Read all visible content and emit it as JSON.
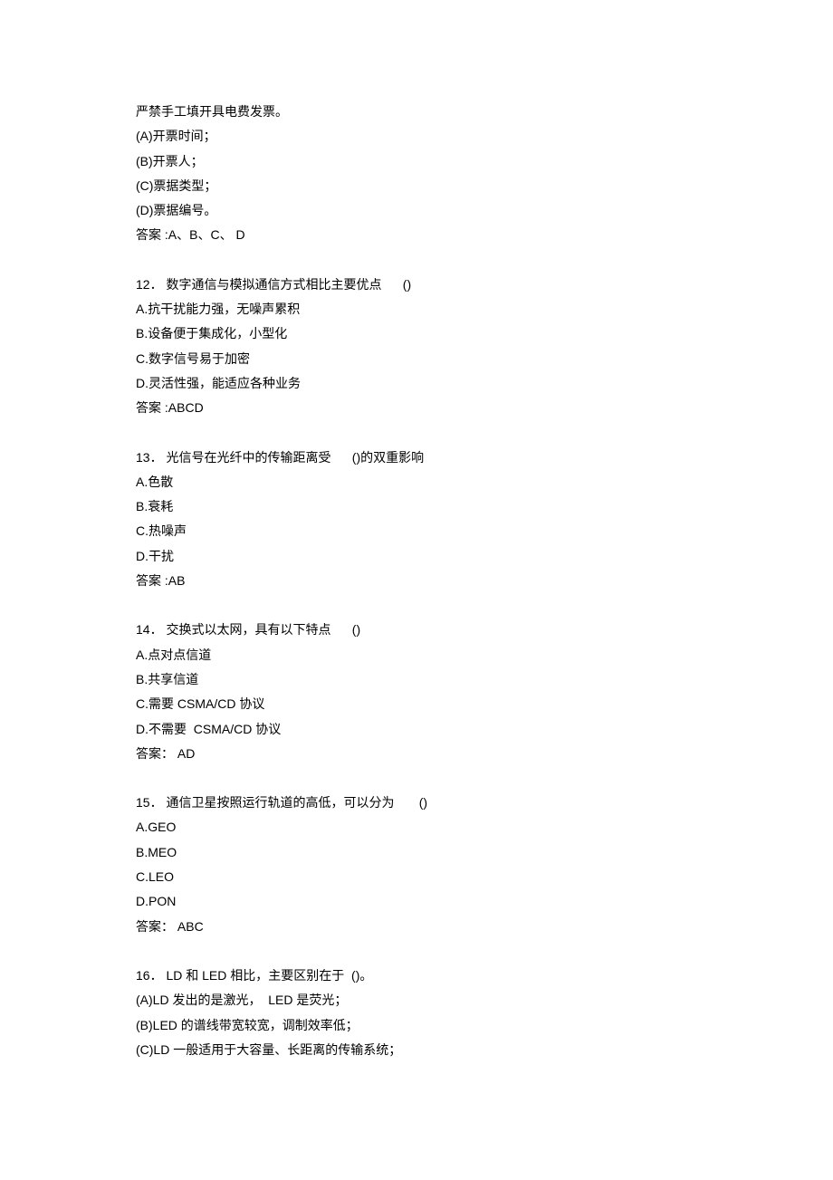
{
  "intro": {
    "line": "严禁手工填开具电费发票。",
    "optA": "(A)开票时间；",
    "optB": "(B)开票人；",
    "optC": "(C)票据类型；",
    "optD": "(D)票据编号。",
    "answer": "答案 :A、B、C、 D"
  },
  "q12": {
    "stem": "12． 数字通信与模拟通信方式相比主要优点      ()",
    "optA": "A.抗干扰能力强，无噪声累积",
    "optB": "B.设备便于集成化，小型化",
    "optC": "C.数字信号易于加密",
    "optD": "D.灵活性强，能适应各种业务",
    "answer": "答案 :ABCD"
  },
  "q13": {
    "stem": "13． 光信号在光纤中的传输距离受      ()的双重影响",
    "optA": "A.色散",
    "optB": "B.衰耗",
    "optC": "C.热噪声",
    "optD": "D.干扰",
    "answer": "答案 :AB"
  },
  "q14": {
    "stem": "14． 交换式以太网，具有以下特点      ()",
    "optA": "A.点对点信道",
    "optB": "B.共享信道",
    "optC": "C.需要 CSMA/CD 协议",
    "optD": "D.不需要  CSMA/CD 协议",
    "answer": "答案： AD"
  },
  "q15": {
    "stem": "15． 通信卫星按照运行轨道的高低，可以分为       ()",
    "optA": "A.GEO",
    "optB": "B.MEO",
    "optC": "C.LEO",
    "optD": "D.PON",
    "answer": "答案： ABC"
  },
  "q16": {
    "stem": "16． LD 和 LED 相比，主要区别在于  ()。",
    "optA": "(A)LD 发出的是激光，  LED 是荧光；",
    "optB": "(B)LED 的谱线带宽较宽，调制效率低；",
    "optC": "(C)LD 一般适用于大容量、长距离的传输系统；"
  }
}
